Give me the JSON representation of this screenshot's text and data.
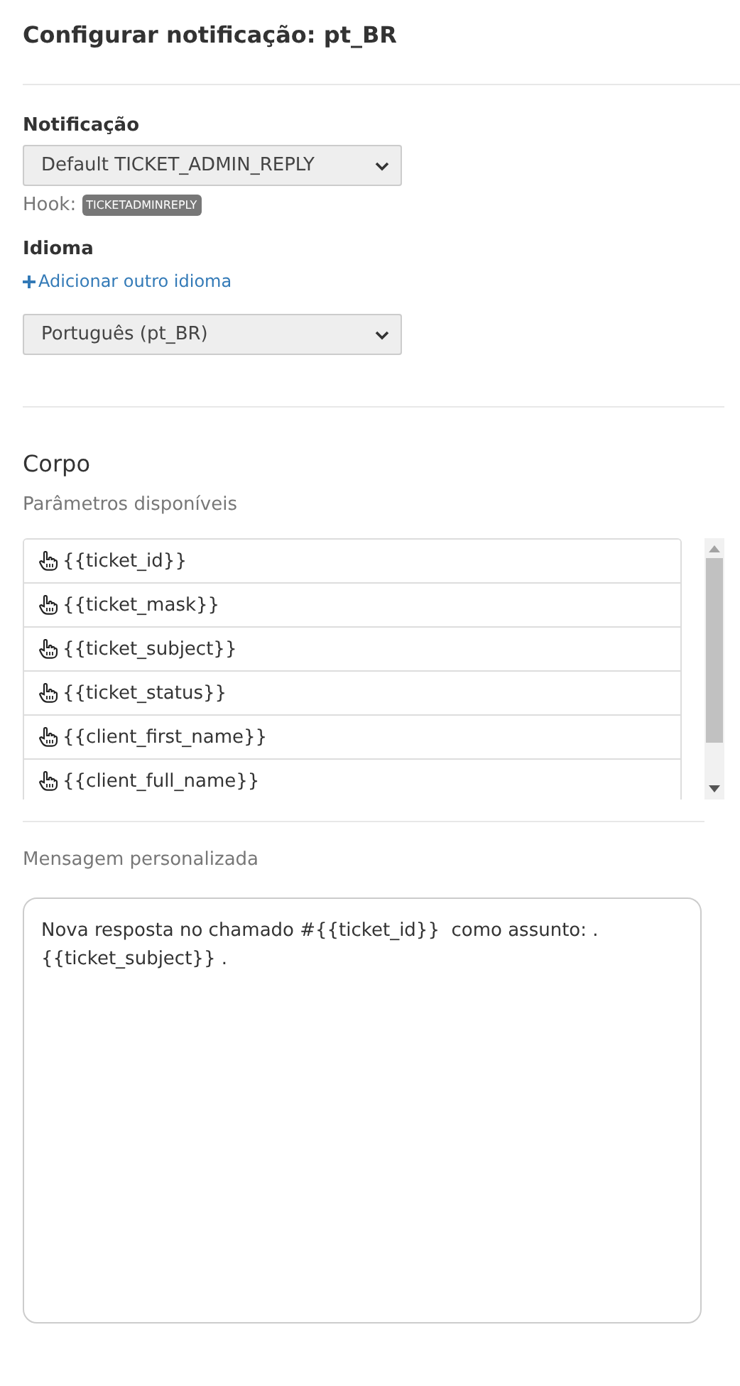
{
  "page_title": "Configurar notificação: pt_BR",
  "notification": {
    "label": "Notificação",
    "value": "Default TICKET_ADMIN_REPLY",
    "hook_label": "Hook:",
    "hook_badge": "TICKETADMINREPLY"
  },
  "language": {
    "label": "Idioma",
    "add_link": "Adicionar outro idioma",
    "value": "Português (pt_BR)"
  },
  "body": {
    "heading": "Corpo",
    "params_label": "Parâmetros disponíveis",
    "params": [
      {
        "label": "{{ticket_id}}"
      },
      {
        "label": "{{ticket_mask}}"
      },
      {
        "label": "{{ticket_subject}}"
      },
      {
        "label": "{{ticket_status}}"
      },
      {
        "label": "{{client_first_name}}"
      },
      {
        "label": "{{client_full_name}}"
      }
    ],
    "message_label": "Mensagem personalizada",
    "message_value": "Nova resposta no chamado #{{ticket_id}}  como assunto: . {{ticket_subject}} ."
  }
}
